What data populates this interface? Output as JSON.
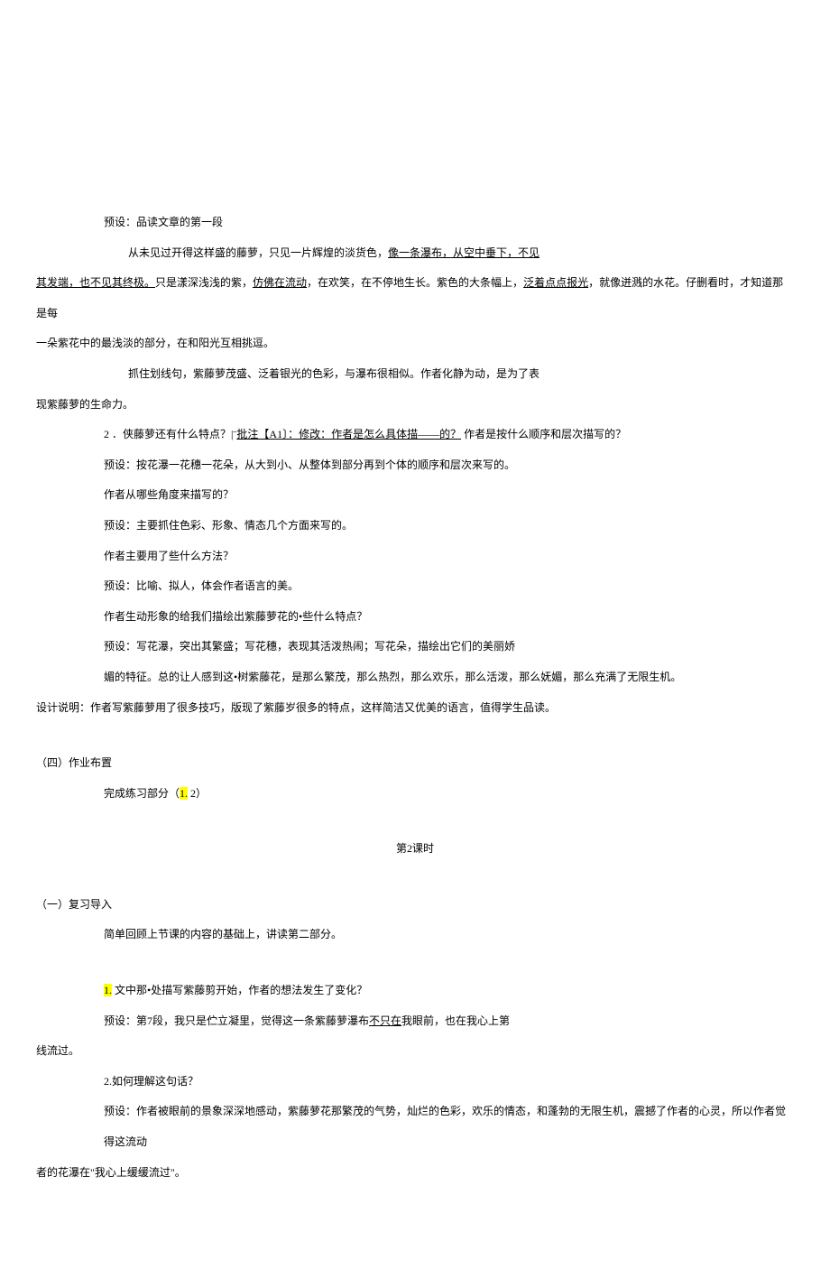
{
  "lines": {
    "l1": "预设：品读文章的第一段",
    "l2a": "从未见过开得这样盛的藤萝，只见一片辉煌的淡货色，",
    "l2b": "像一条瀑布，从空中垂下，不见",
    "l3a": "其发端，也不见其终极。",
    "l3b": "只是漾深浅浅的紫，",
    "l3c": "仿佛在流动",
    "l3d": "，在欢笑，在不停地生长。紫色的大条幅上，",
    "l3e": "泛着点点报光",
    "l3f": "，就像迸溅的水花。仔删看时，才知道那是每",
    "l4": "一朵紫花中的最浅淡的部分，在和阳光互相挑逗。",
    "l5": "抓住划线句，紫藤萝茂盛、泛着银光的色彩，与瀑布很相似。作者化静为动，是为了表",
    "l6": "现紫藤萝的生命力。",
    "l7a": "2 ．侠藤萝还有什么特点？|¨",
    "l7b": "批注【A1〕：修改：作者是怎么具体描——的？",
    "l7c": " 作者是按什么顺序和层次描写的？",
    "l8": "预设：按花瀑一花穗一花朵，从大到小、从整体到部分再到个体的顺序和层次来写的。",
    "l9": "作者从哪些角度来描写的？",
    "l10": "预设：主要抓住色彩、形象、情态几个方面来写的。",
    "l11": "作者主要用了些什么方法？",
    "l12": "预设：比喻、拟人，体会作者语言的美。",
    "l13": "作者生动形象的给我们描绘出紫藤萝花的•些什么特点？",
    "l14": "预设：写花瀑，突出其繁盛；写花穗，表现其活泼热闹；写花朵，描绘出它们的美丽娇",
    "l15": "媚的特征。总的让人感到这•树紫藤花，是那么繁茂，那么热烈，那么欢乐，那么活泼，那么妩媚，那么充满了无限生机。",
    "l16": "设计说明：作者写紫藤萝用了很多技巧，版现了紫藤岁很多的特点，这样简洁又优美的语言，值得学生品读。",
    "l17": "（四）作业布置",
    "l18a": "完成练习部分（",
    "l18b": "1.",
    "l18c": " 2）",
    "l19": "第2课时",
    "l20": "（一）复习导入",
    "l21": "简单回顾上节课的内容的基础上，讲读第二部分。",
    "l22a": "1.",
    "l22b": " 文中那•处描写紫藤剪开始，作者的想法发生了变化？",
    "l23a": "预设：第7段，我只是伫立凝里，觉得这一条紫藤萝瀑布",
    "l23b": "不只在",
    "l23c": "我眼前，也在我心上第",
    "l24": "线流过。",
    "l25": "2.如何理解这句话？",
    "l26": "预设：作者被眼前的景象深深地感动，紫藤萝花那繁茂的气势，灿烂的色彩，欢乐的情态，和蓬勃的无限生机，震撼了作者的心灵，所以作者觉得这流动",
    "l27": "者的花瀑在\"我心上缓缓流过\"。"
  }
}
